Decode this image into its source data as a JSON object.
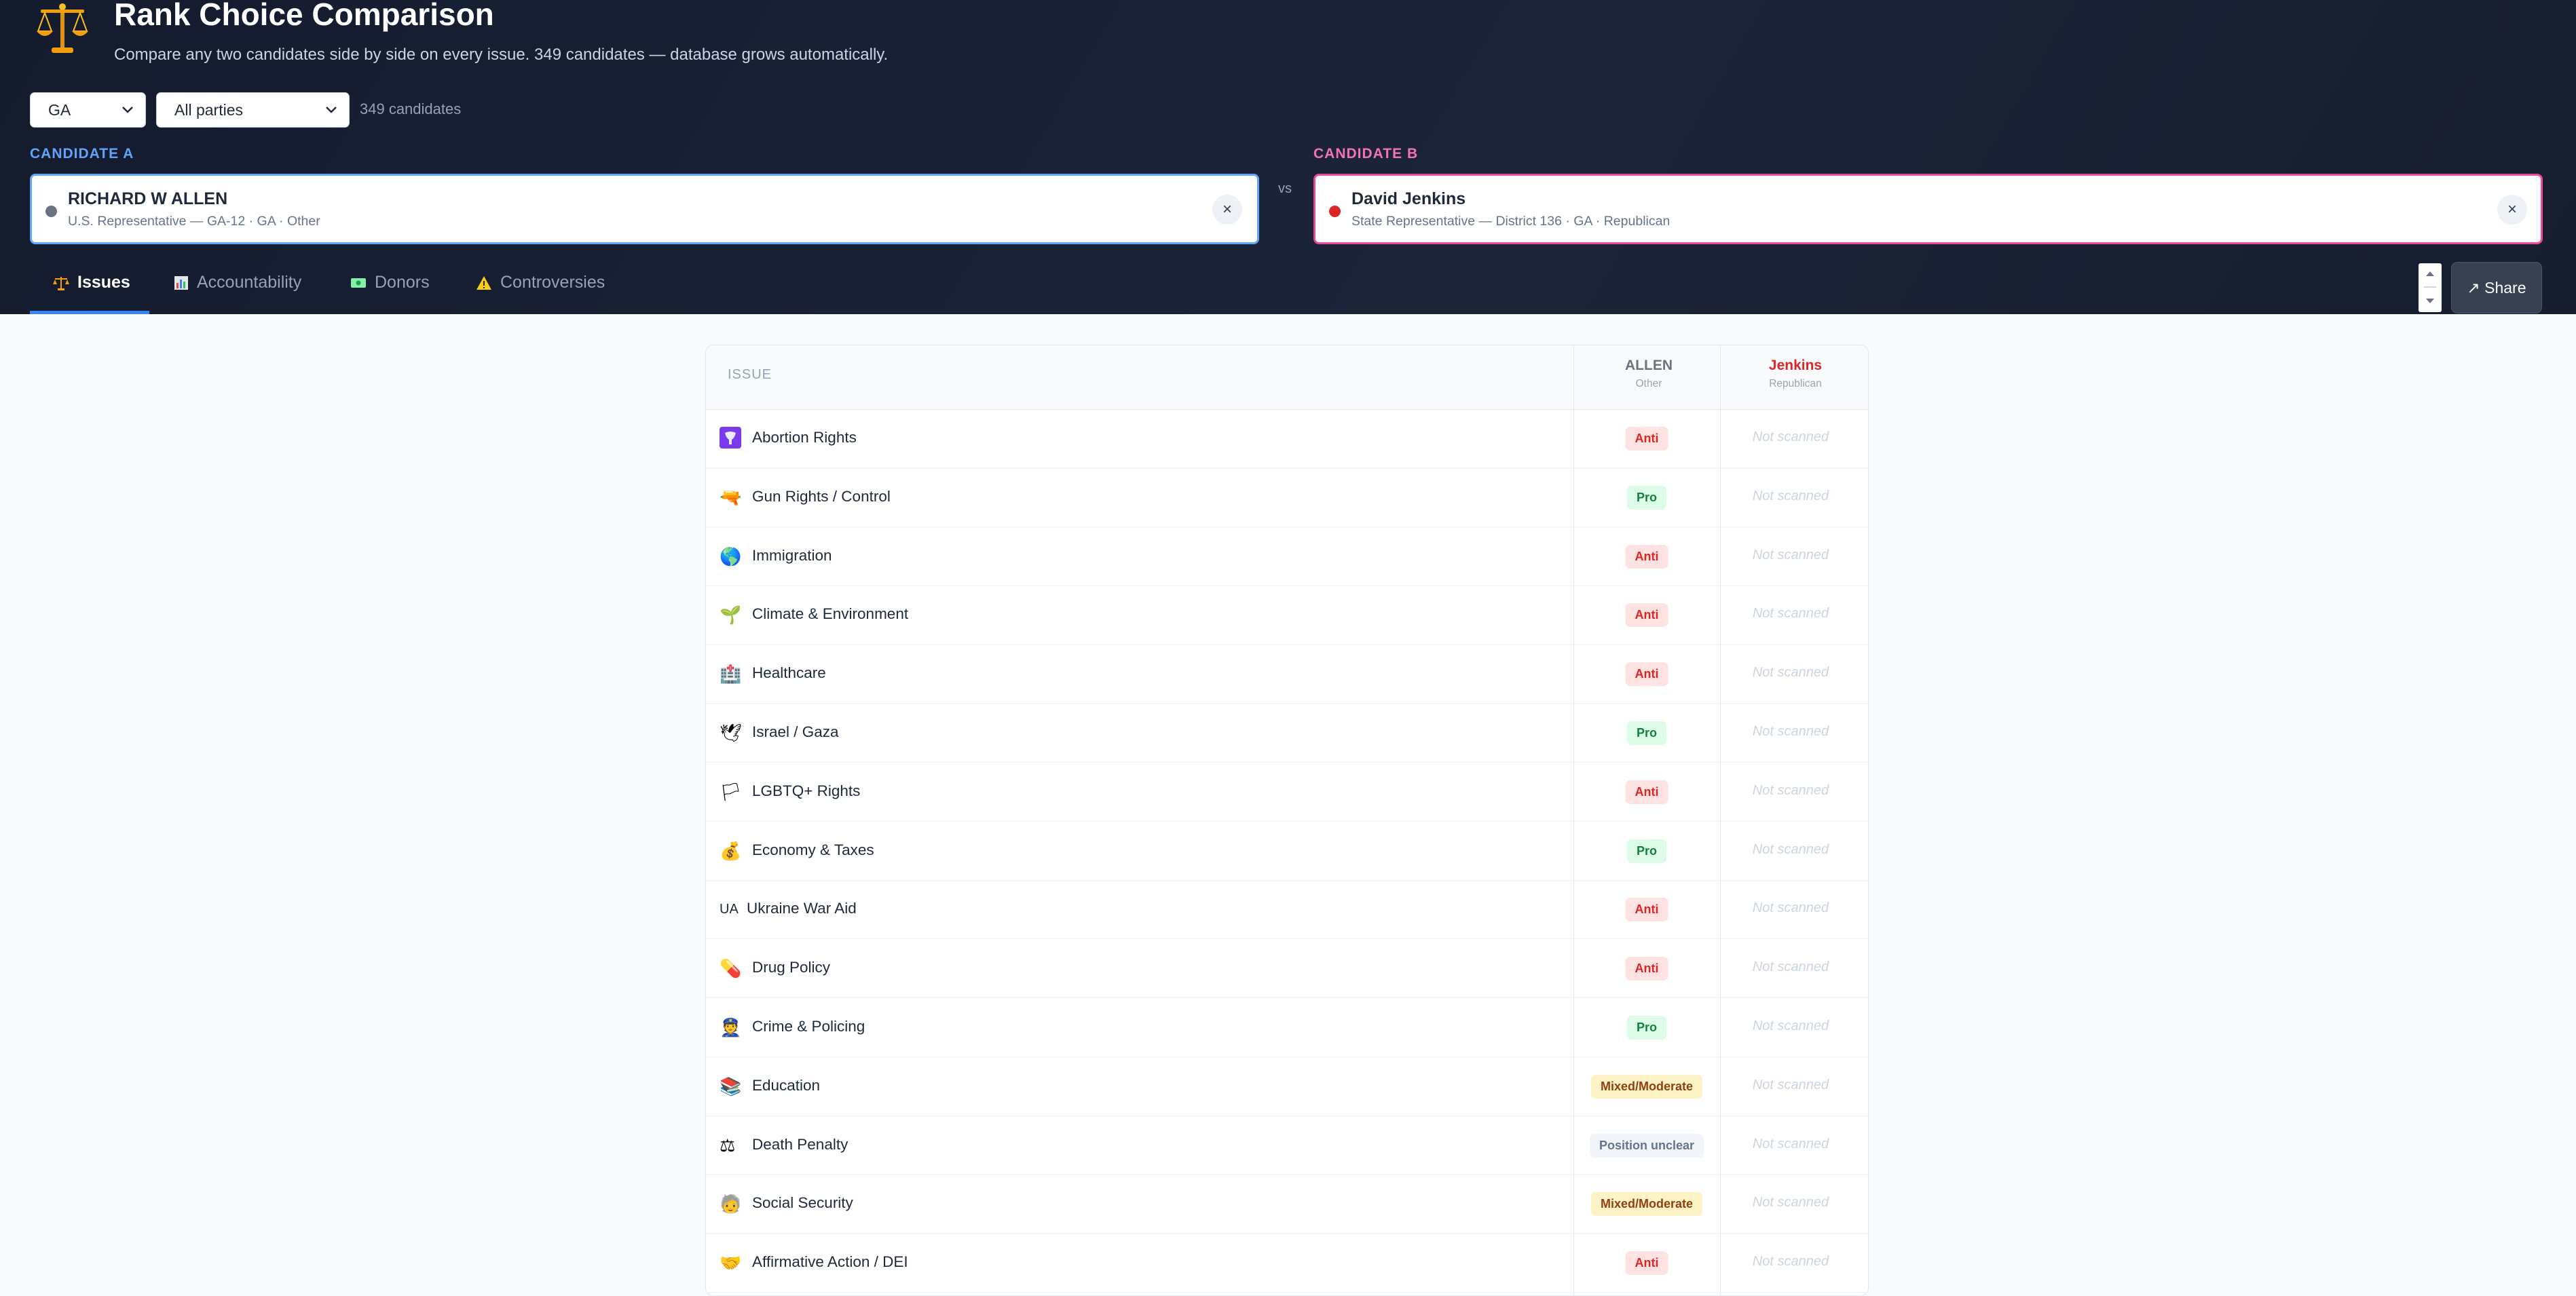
{
  "app": {
    "title": "Rank Choice Comparison",
    "subtitle": "Compare any two candidates side by side on every issue. 349 candidates — database grows automatically.",
    "logo_icon": "scales-icon"
  },
  "filters": {
    "state": "GA",
    "party": "All parties",
    "count": "349 candidates"
  },
  "candidate_a": {
    "label": "CANDIDATE A",
    "name": "RICHARD W ALLEN",
    "meta": "U.S. Representative — GA-12 · GA · Other",
    "dot_color": "#6b7280",
    "accent": "#60a5fa"
  },
  "vs": "vs",
  "candidate_b": {
    "label": "CANDIDATE B",
    "name": "David Jenkins",
    "meta": "State Representative — District 136 · GA · Republican",
    "dot_color": "#dc2626",
    "accent": "#ec4899"
  },
  "tabs": [
    {
      "label": "Issues",
      "icon": "scales-icon"
    },
    {
      "label": "Accountability",
      "icon": "bar-chart-icon"
    },
    {
      "label": "Donors",
      "icon": "money-icon"
    },
    {
      "label": "Controversies",
      "icon": "warning-icon"
    }
  ],
  "share": "↗ Share",
  "table": {
    "issue_header": "ISSUE",
    "col_a": {
      "name": "ALLEN",
      "party": "Other",
      "color": "#6b7280"
    },
    "col_b": {
      "name": "Jenkins",
      "party": "Republican",
      "color": "#dc2626"
    },
    "rows": [
      {
        "icon": "uterus-icon",
        "issue": "Abortion Rights",
        "a": "Anti",
        "b": "Not scanned"
      },
      {
        "icon": "water-gun-icon",
        "issue": "Gun Rights / Control",
        "a": "Pro",
        "b": "Not scanned"
      },
      {
        "icon": "globe-icon",
        "issue": "Immigration",
        "a": "Anti",
        "b": "Not scanned"
      },
      {
        "icon": "seedling-icon",
        "issue": "Climate & Environment",
        "a": "Anti",
        "b": "Not scanned"
      },
      {
        "icon": "hospital-icon",
        "issue": "Healthcare",
        "a": "Anti",
        "b": "Not scanned"
      },
      {
        "icon": "dove-icon",
        "issue": "Israel / Gaza",
        "a": "Pro",
        "b": "Not scanned"
      },
      {
        "icon": "rainbow-flag-icon",
        "issue": "LGBTQ+ Rights",
        "a": "Anti",
        "b": "Not scanned"
      },
      {
        "icon": "money-bag-icon",
        "issue": "Economy & Taxes",
        "a": "Pro",
        "b": "Not scanned"
      },
      {
        "icon": "flag-ua-icon",
        "icon_text": "UA",
        "issue": "Ukraine War Aid",
        "a": "Anti",
        "b": "Not scanned"
      },
      {
        "icon": "pill-icon",
        "issue": "Drug Policy",
        "a": "Anti",
        "b": "Not scanned"
      },
      {
        "icon": "police-officer-icon",
        "issue": "Crime & Policing",
        "a": "Pro",
        "b": "Not scanned"
      },
      {
        "icon": "books-icon",
        "issue": "Education",
        "a": "Mixed/Moderate",
        "b": "Not scanned"
      },
      {
        "icon": "scales-icon",
        "issue": "Death Penalty",
        "a": "Position unclear",
        "b": "Not scanned"
      },
      {
        "icon": "older-person-icon",
        "issue": "Social Security",
        "a": "Mixed/Moderate",
        "b": "Not scanned"
      },
      {
        "icon": "handshake-icon",
        "issue": "Affirmative Action / DEI",
        "a": "Anti",
        "b": "Not scanned"
      }
    ]
  }
}
